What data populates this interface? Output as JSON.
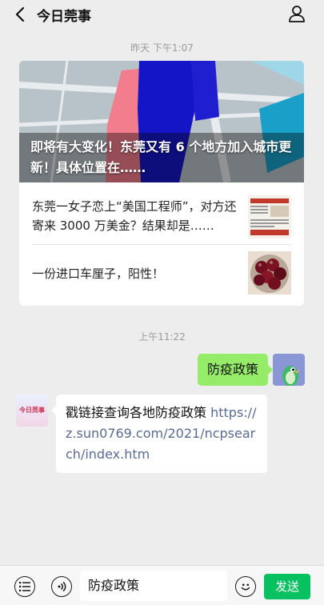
{
  "header": {
    "title": "今日莞事",
    "back_icon": "chevron-left-icon",
    "profile_icon": "person-icon"
  },
  "timestamps": [
    "昨天 下午1:07",
    "上午11:22"
  ],
  "article_card": {
    "hero_title": "即将有大变化！东莞又有 6 个地方加入城市更新！具体位置在……",
    "items": [
      {
        "title": "东莞一女子恋上“美国工程师”，对方还寄来 3000 万美金？结果却是……",
        "thumb": "newspaper-thumbnail"
      },
      {
        "title": "一份进口车厘子，阳性！",
        "thumb": "cherries-thumbnail"
      }
    ]
  },
  "messages": {
    "outgoing": {
      "text": "防疫政策"
    },
    "incoming": {
      "avatar_text": "今日莞事",
      "prefix": "戳链接查询各地防疫政策",
      "link": "https://z.sun0769.com/2021/ncpsearch/index.htm"
    }
  },
  "input_bar": {
    "menu_icon": "list-menu-icon",
    "voice_icon": "voice-icon",
    "input_value": "防疫政策",
    "emoji_icon": "emoji-icon",
    "send_label": "发送"
  },
  "colors": {
    "background": "#ededed",
    "outgoing_bubble": "#95ec69",
    "send_button": "#07c160",
    "link": "#576b95"
  }
}
